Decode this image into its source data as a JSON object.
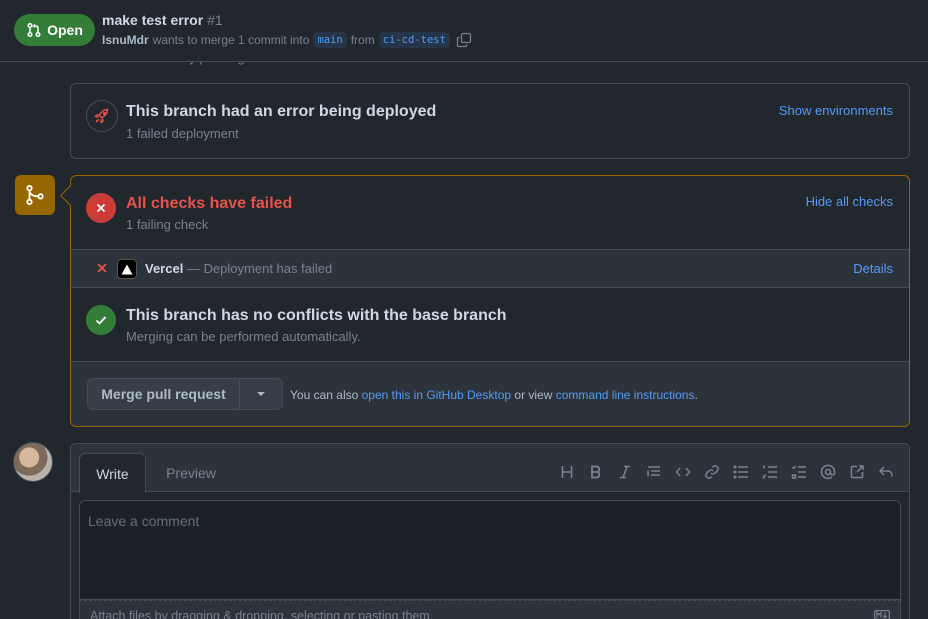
{
  "header": {
    "state_label": "Open",
    "title": "make test error",
    "number": "#1",
    "author": "IsnuMdr",
    "meta_text": "wants to merge 1 commit into",
    "base_branch": "main",
    "from_text": "from",
    "head_branch": "ci-cd-test"
  },
  "peek_text": "Add more commits by pushing to the ci-cd-test branch on IsnuMdr/mdr-ferum.",
  "deployment": {
    "title": "This branch had an error being deployed",
    "subtitle": "1 failed deployment",
    "link": "Show environments"
  },
  "checks": {
    "title": "All checks have failed",
    "subtitle": "1 failing check",
    "toggle_link": "Hide all checks",
    "items": [
      {
        "name": "Vercel",
        "description": "— Deployment has failed",
        "link": "Details"
      }
    ]
  },
  "conflicts": {
    "title": "This branch has no conflicts with the base branch",
    "subtitle": "Merging can be performed automatically."
  },
  "merge": {
    "button_label": "Merge pull request",
    "note_prefix": "You can also",
    "desktop_link": "open this in GitHub Desktop",
    "note_middle": "or view",
    "cli_link": "command line instructions",
    "note_suffix": "."
  },
  "comment": {
    "tabs": [
      "Write",
      "Preview"
    ],
    "placeholder": "Leave a comment",
    "attach_text": "Attach files by dragging & dropping, selecting or pasting them.",
    "toolbar_icons": [
      "heading-icon",
      "bold-icon",
      "italic-icon",
      "quote-icon",
      "code-icon",
      "link-icon",
      "unordered-list-icon",
      "ordered-list-icon",
      "task-list-icon",
      "mention-icon",
      "reference-icon",
      "reply-icon"
    ]
  },
  "colors": {
    "open_green": "#347d39",
    "fail_red": "#e5534b",
    "warning_border": "#966600",
    "link_blue": "#539bf5"
  }
}
